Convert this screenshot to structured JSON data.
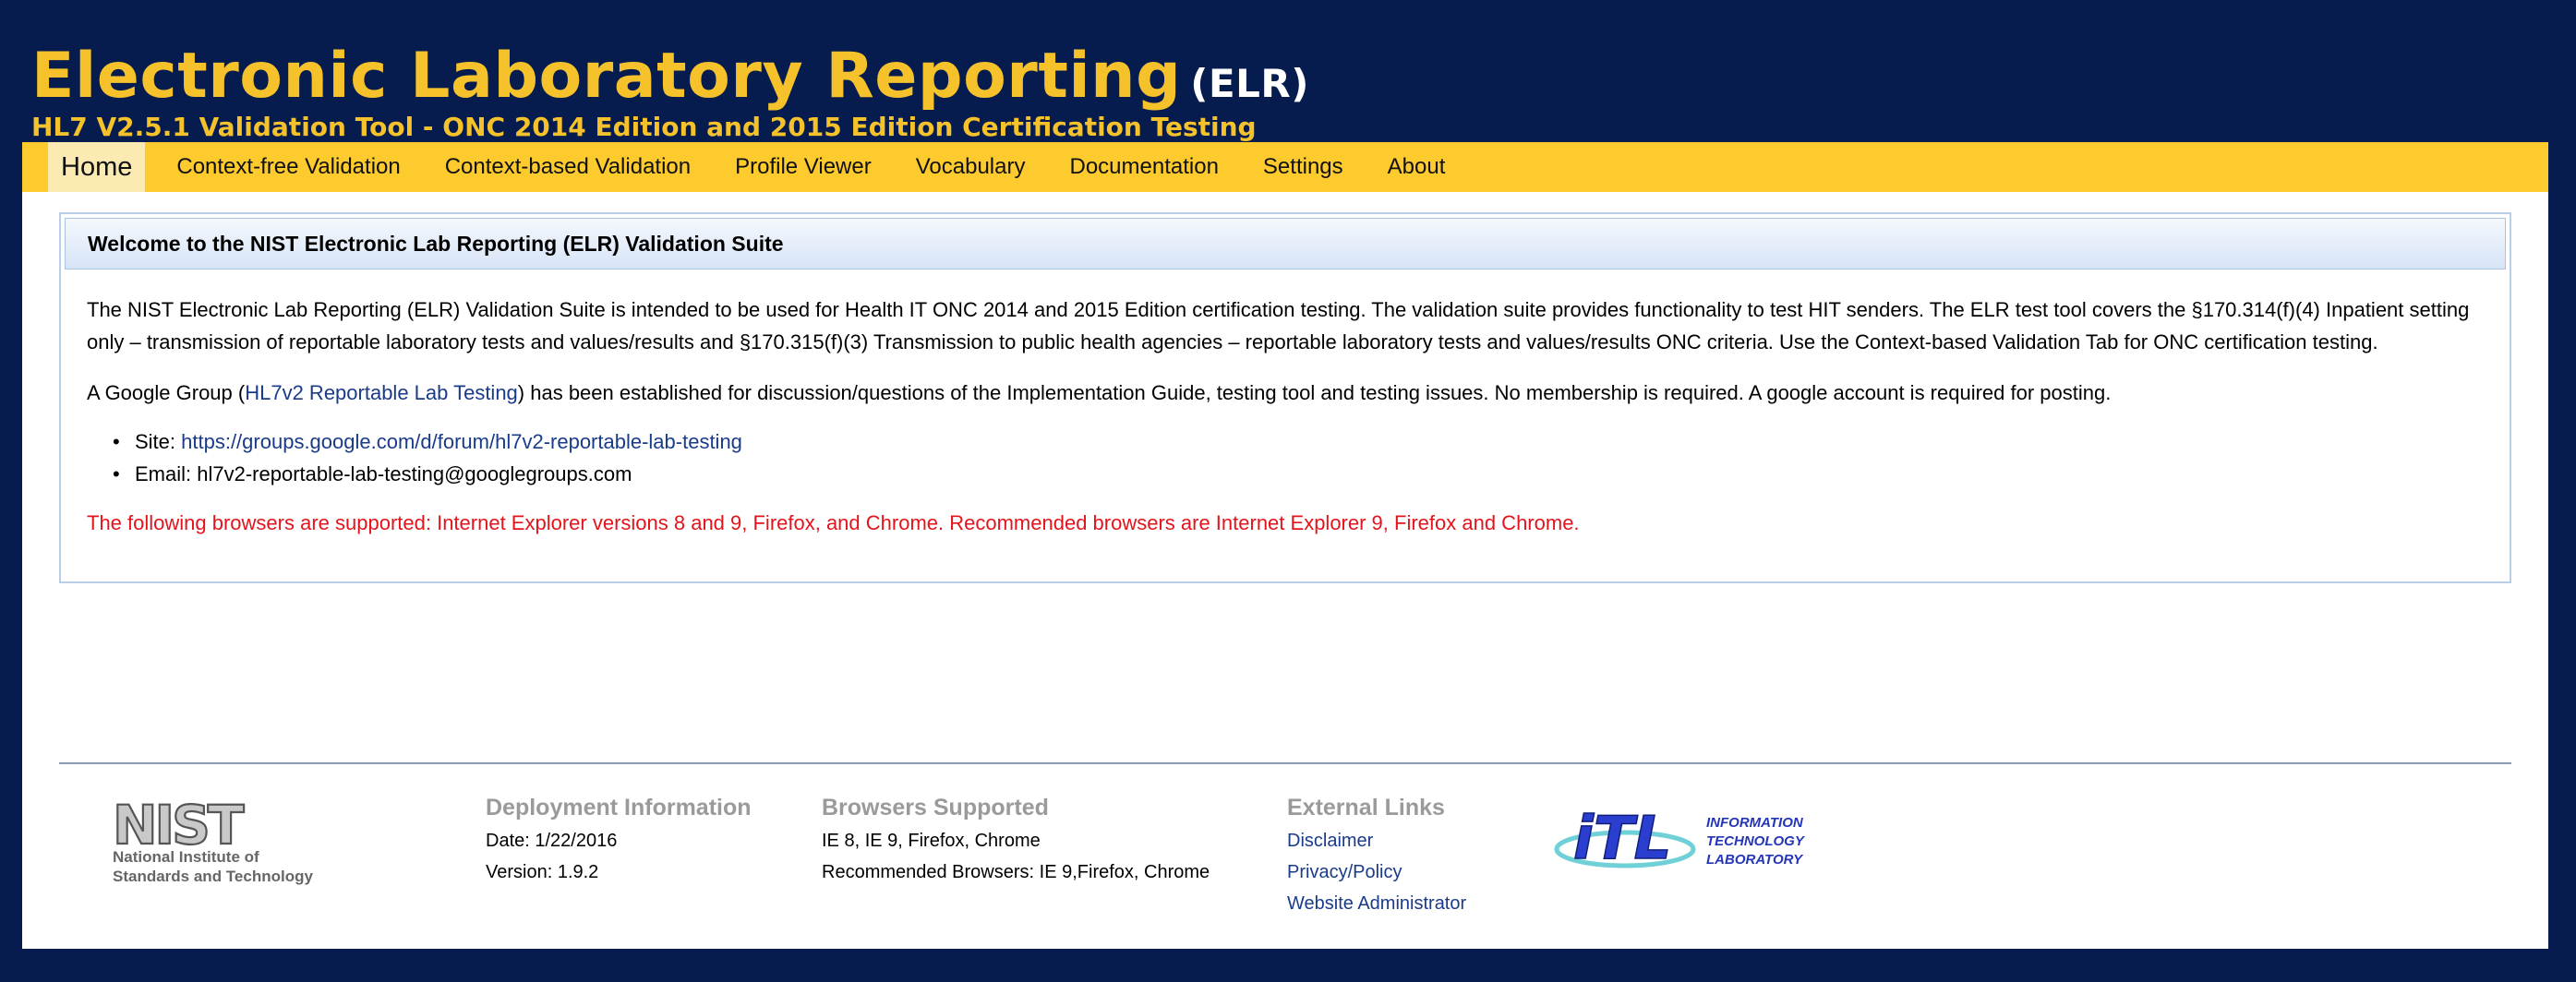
{
  "header": {
    "title": "Electronic Laboratory Reporting",
    "title_abbr": "(ELR)",
    "subtitle": "HL7 V2.5.1 Validation Tool - ONC 2014 Edition and 2015 Edition Certification Testing"
  },
  "nav": {
    "items": [
      {
        "label": "Home",
        "active": true
      },
      {
        "label": "Context-free Validation"
      },
      {
        "label": "Context-based Validation"
      },
      {
        "label": "Profile Viewer"
      },
      {
        "label": "Vocabulary"
      },
      {
        "label": "Documentation"
      },
      {
        "label": "Settings"
      },
      {
        "label": "About"
      }
    ]
  },
  "welcome": {
    "heading": "Welcome to the NIST Electronic Lab Reporting (ELR) Validation Suite",
    "intro": "The NIST Electronic Lab Reporting (ELR) Validation Suite is intended to be used for Health IT ONC 2014 and 2015 Edition certification testing. The validation suite provides functionality to test HIT senders. The ELR test tool covers the §170.314(f)(4) Inpatient setting only – transmission of reportable laboratory tests and values/results and §170.315(f)(3) Transmission to public health agencies – reportable laboratory tests and values/results ONC criteria. Use the Context-based Validation Tab for ONC certification testing.",
    "group_prefix": "A Google Group (",
    "group_link": "HL7v2 Reportable Lab Testing",
    "group_suffix": ") has been established for discussion/questions of the Implementation Guide, testing tool and testing issues. No membership is required. A google account is required for posting.",
    "site_label": "Site: ",
    "site_url": "https://groups.google.com/d/forum/hl7v2-reportable-lab-testing",
    "email_label": "Email: ",
    "email": "hl7v2-reportable-lab-testing@googlegroups.com",
    "browser_notice": "The following browsers are supported: Internet Explorer versions 8 and 9, Firefox, and Chrome. Recommended browsers are Internet Explorer 9, Firefox and Chrome."
  },
  "footer": {
    "nist_logo": {
      "wordmark": "NIST",
      "line1": "National Institute of",
      "line2": "Standards and Technology"
    },
    "deployment": {
      "heading": "Deployment Information",
      "date": "Date: 1/22/2016",
      "version": "Version: 1.9.2"
    },
    "browsers": {
      "heading": "Browsers Supported",
      "supported": "IE 8, IE 9, Firefox, Chrome",
      "recommended": "Recommended Browsers: IE 9,Firefox, Chrome"
    },
    "external": {
      "heading": "External Links",
      "links": [
        "Disclaimer",
        "Privacy/Policy",
        "Website Administrator"
      ]
    },
    "itl_logo": {
      "wordmark": "iTL",
      "line1": "INFORMATION",
      "line2": "TECHNOLOGY",
      "line3": "LABORATORY"
    }
  },
  "colors": {
    "background": "#061c4e",
    "accent_gold": "#f5c22b",
    "nav_bar": "#fdcb2e",
    "link": "#1a3b8a",
    "warning_red": "#e3141c"
  }
}
